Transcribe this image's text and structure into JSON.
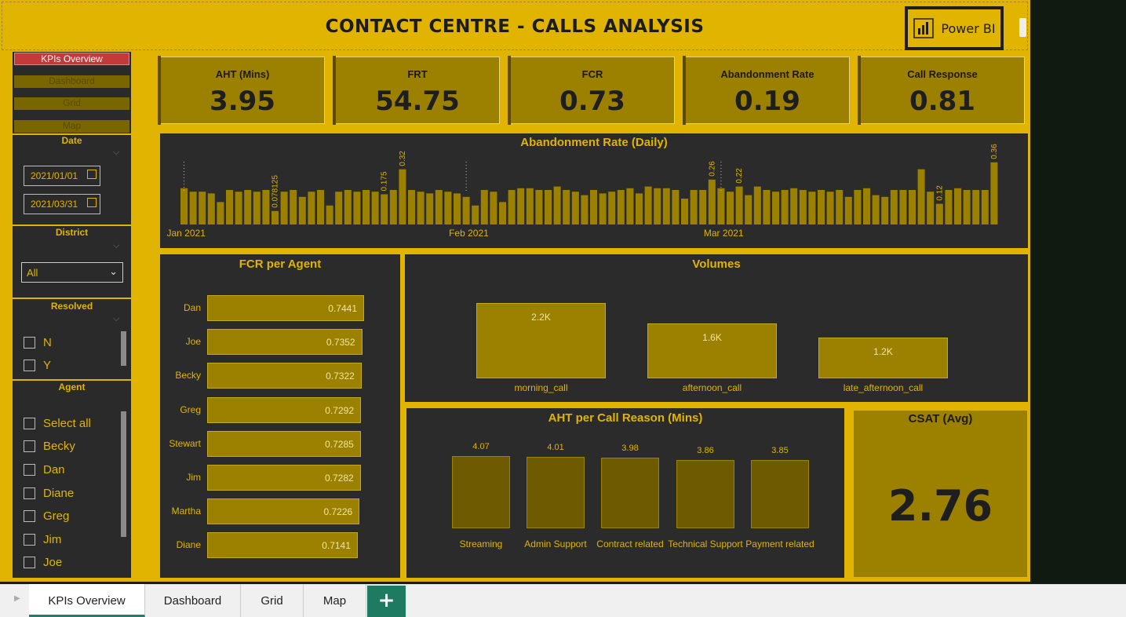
{
  "header": {
    "title": "CONTACT CENTRE - CALLS ANALYSIS",
    "logo_text": "Power BI"
  },
  "nav": {
    "items": [
      "KPIs Overview",
      "Dashboard",
      "Grid",
      "Map"
    ]
  },
  "filters": {
    "date": {
      "title": "Date",
      "start": "2021/01/01",
      "end": "2021/03/31"
    },
    "district": {
      "title": "District",
      "selected": "All"
    },
    "resolved": {
      "title": "Resolved",
      "options": [
        "N",
        "Y"
      ]
    },
    "agent": {
      "title": "Agent",
      "options": [
        "Select all",
        "Becky",
        "Dan",
        "Diane",
        "Greg",
        "Jim",
        "Joe"
      ]
    }
  },
  "kpis": [
    {
      "label": "AHT (Mins)",
      "value": "3.95"
    },
    {
      "label": "FRT",
      "value": "54.75"
    },
    {
      "label": "FCR",
      "value": "0.73"
    },
    {
      "label": "Abandonment Rate",
      "value": "0.19"
    },
    {
      "label": "Call Response",
      "value": "0.81"
    }
  ],
  "abandonment": {
    "title": "Abandonment Rate (Daily)",
    "x_labels": [
      "Jan 2021",
      "Feb 2021",
      "Mar 2021"
    ],
    "labels": [
      "0.078125",
      "0.175",
      "0.32",
      "0.26",
      "0.22",
      "0.12",
      "0.36"
    ]
  },
  "fcr_agent": {
    "title": "FCR per Agent",
    "agents": [
      "Dan",
      "Joe",
      "Becky",
      "Greg",
      "Stewart",
      "Jim",
      "Martha",
      "Diane"
    ],
    "values": [
      "0.7441",
      "0.7352",
      "0.7322",
      "0.7292",
      "0.7285",
      "0.7282",
      "0.7226",
      "0.7141"
    ]
  },
  "volumes": {
    "title": "Volumes",
    "categories": [
      "morning_call",
      "afternoon_call",
      "late_afternoon_call"
    ],
    "values": [
      "2.2K",
      "1.6K",
      "1.2K"
    ]
  },
  "aht_reason": {
    "title": "AHT per Call Reason (Mins)",
    "categories": [
      "Streaming",
      "Admin Support",
      "Contract related",
      "Technical Support",
      "Payment related"
    ],
    "values": [
      "4.07",
      "4.01",
      "3.98",
      "3.86",
      "3.85"
    ]
  },
  "csat": {
    "title": "CSAT (Avg)",
    "value": "2.76"
  },
  "tabs": {
    "items": [
      "KPIs Overview",
      "Dashboard",
      "Grid",
      "Map"
    ],
    "add": "+"
  },
  "chart_data": [
    {
      "type": "bar",
      "title": "Abandonment Rate (Daily)",
      "x": [
        "2021-01-01",
        "2021-01-02",
        "2021-01-03",
        "2021-01-04",
        "2021-01-05",
        "2021-01-06",
        "2021-01-07",
        "2021-01-08",
        "2021-01-09",
        "2021-01-10",
        "2021-01-11",
        "2021-01-12",
        "2021-01-13",
        "2021-01-14",
        "2021-01-15",
        "2021-01-16",
        "2021-01-17",
        "2021-01-18",
        "2021-01-19",
        "2021-01-20",
        "2021-01-21",
        "2021-01-22",
        "2021-01-23",
        "2021-01-24",
        "2021-01-25",
        "2021-01-26",
        "2021-01-27",
        "2021-01-28",
        "2021-01-29",
        "2021-01-30",
        "2021-01-31",
        "2021-02-01",
        "2021-02-02",
        "2021-02-03",
        "2021-02-04",
        "2021-02-05",
        "2021-02-06",
        "2021-02-07",
        "2021-02-08",
        "2021-02-09",
        "2021-02-10",
        "2021-02-11",
        "2021-02-12",
        "2021-02-13",
        "2021-02-14",
        "2021-02-15",
        "2021-02-16",
        "2021-02-17",
        "2021-02-18",
        "2021-02-19",
        "2021-02-20",
        "2021-02-21",
        "2021-02-22",
        "2021-02-23",
        "2021-02-24",
        "2021-02-25",
        "2021-02-26",
        "2021-02-27",
        "2021-02-28",
        "2021-03-01",
        "2021-03-02",
        "2021-03-03",
        "2021-03-04",
        "2021-03-05",
        "2021-03-06",
        "2021-03-07",
        "2021-03-08",
        "2021-03-09",
        "2021-03-10",
        "2021-03-11",
        "2021-03-12",
        "2021-03-13",
        "2021-03-14",
        "2021-03-15",
        "2021-03-16",
        "2021-03-17",
        "2021-03-18",
        "2021-03-19",
        "2021-03-20",
        "2021-03-21",
        "2021-03-22",
        "2021-03-23",
        "2021-03-24",
        "2021-03-25",
        "2021-03-26",
        "2021-03-27",
        "2021-03-28",
        "2021-03-29",
        "2021-03-30",
        "2021-03-31"
      ],
      "values": [
        0.21,
        0.19,
        0.19,
        0.18,
        0.13,
        0.2,
        0.19,
        0.2,
        0.19,
        0.2,
        0.078125,
        0.19,
        0.2,
        0.16,
        0.19,
        0.2,
        0.11,
        0.19,
        0.2,
        0.19,
        0.2,
        0.19,
        0.175,
        0.2,
        0.32,
        0.2,
        0.19,
        0.18,
        0.2,
        0.19,
        0.18,
        0.16,
        0.11,
        0.2,
        0.19,
        0.13,
        0.2,
        0.21,
        0.21,
        0.2,
        0.2,
        0.22,
        0.2,
        0.19,
        0.17,
        0.2,
        0.18,
        0.19,
        0.2,
        0.21,
        0.18,
        0.22,
        0.21,
        0.21,
        0.2,
        0.15,
        0.2,
        0.2,
        0.26,
        0.21,
        0.19,
        0.22,
        0.17,
        0.22,
        0.2,
        0.19,
        0.2,
        0.21,
        0.2,
        0.19,
        0.2,
        0.19,
        0.2,
        0.16,
        0.2,
        0.21,
        0.17,
        0.16,
        0.2,
        0.2,
        0.2,
        0.32,
        0.19,
        0.12,
        0.2,
        0.21,
        0.2,
        0.2,
        0.2,
        0.36
      ],
      "label_indices": [
        10,
        22,
        24,
        58,
        61,
        83,
        89
      ],
      "xlabel": "",
      "ylabel": ""
    },
    {
      "type": "bar",
      "title": "FCR per Agent",
      "categories": [
        "Dan",
        "Joe",
        "Becky",
        "Greg",
        "Stewart",
        "Jim",
        "Martha",
        "Diane"
      ],
      "values": [
        0.7441,
        0.7352,
        0.7322,
        0.7292,
        0.7285,
        0.7282,
        0.7226,
        0.7141
      ]
    },
    {
      "type": "bar",
      "title": "Volumes",
      "categories": [
        "morning_call",
        "afternoon_call",
        "late_afternoon_call"
      ],
      "values": [
        2200,
        1600,
        1200
      ]
    },
    {
      "type": "bar",
      "title": "AHT per Call Reason (Mins)",
      "categories": [
        "Streaming",
        "Admin Support",
        "Contract related",
        "Technical Support",
        "Payment related"
      ],
      "values": [
        4.07,
        4.01,
        3.98,
        3.86,
        3.85
      ]
    }
  ],
  "colors": {
    "accent": "#e0b400",
    "bar": "#9c8100",
    "panel": "#2b2b2b",
    "active_nav": "#c43a3a",
    "tab_add": "#1f7a62"
  }
}
